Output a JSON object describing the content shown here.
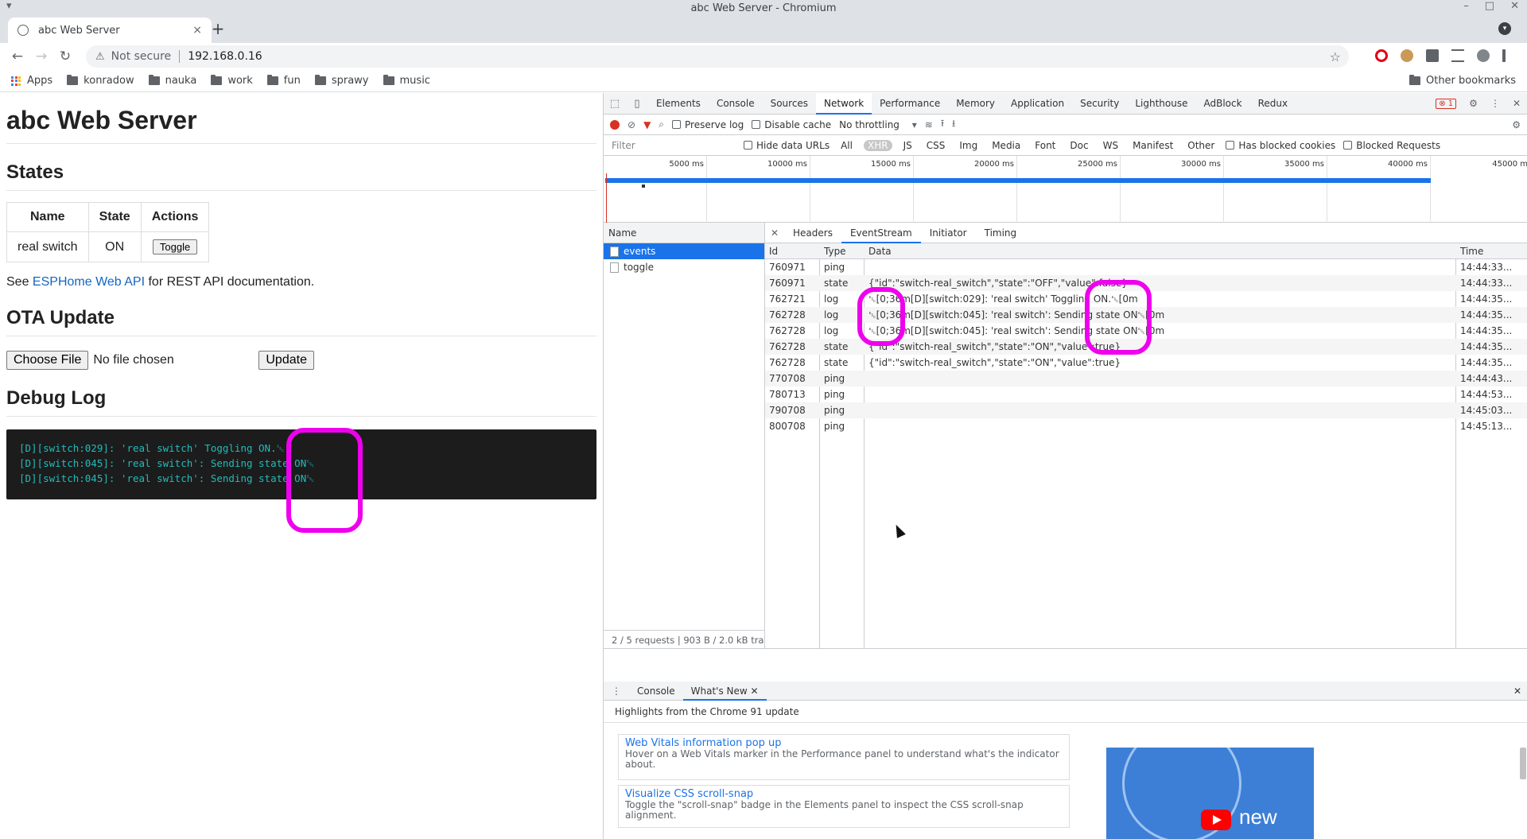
{
  "window": {
    "title": "abc Web Server - Chromium"
  },
  "tab": {
    "title": "abc Web Server",
    "close": "×",
    "new": "+"
  },
  "toolbar": {
    "security": "Not secure",
    "url": "192.168.0.16"
  },
  "bookmarks": {
    "items": [
      "Apps",
      "konradow",
      "nauka",
      "work",
      "fun",
      "sprawy",
      "music"
    ],
    "other": "Other bookmarks"
  },
  "page": {
    "title": "abc Web Server",
    "states_heading": "States",
    "table": {
      "headers": [
        "Name",
        "State",
        "Actions"
      ],
      "rows": [
        {
          "name": "real switch",
          "state": "ON",
          "action": "Toggle"
        }
      ]
    },
    "api_prefix": "See ",
    "api_link": "ESPHome Web API",
    "api_suffix": " for REST API documentation.",
    "ota_heading": "OTA Update",
    "choose_file": "Choose File",
    "no_file": "No file chosen",
    "update": "Update",
    "debug_heading": "Debug Log",
    "log_lines": [
      "[D][switch:029]: 'real switch' Toggling ON.␛",
      "[D][switch:045]: 'real switch': Sending state ON␛",
      "[D][switch:045]: 'real switch': Sending state ON␛"
    ]
  },
  "devtools": {
    "tabs": [
      "Elements",
      "Console",
      "Sources",
      "Network",
      "Performance",
      "Memory",
      "Application",
      "Security",
      "Lighthouse",
      "AdBlock",
      "Redux"
    ],
    "active_tab": "Network",
    "error_count": "1",
    "toolbar": {
      "preserve_log": "Preserve log",
      "disable_cache": "Disable cache",
      "throttling": "No throttling"
    },
    "filter": {
      "placeholder": "Filter",
      "hide_data_urls": "Hide data URLs",
      "types": [
        "All",
        "XHR",
        "JS",
        "CSS",
        "Img",
        "Media",
        "Font",
        "Doc",
        "WS",
        "Manifest",
        "Other"
      ],
      "active_type": "XHR",
      "has_blocked_cookies": "Has blocked cookies",
      "blocked_requests": "Blocked Requests"
    },
    "timeline_ticks": [
      "5000 ms",
      "10000 ms",
      "15000 ms",
      "20000 ms",
      "25000 ms",
      "30000 ms",
      "35000 ms",
      "40000 ms",
      "45000 m"
    ],
    "requests_header": "Name",
    "requests": [
      "events",
      "toggle"
    ],
    "selected_request": "events",
    "footer": "2 / 5 requests  |  903 B / 2.0 kB tra",
    "detail_tabs": [
      "Headers",
      "EventStream",
      "Initiator",
      "Timing"
    ],
    "active_detail_tab": "EventStream",
    "eventstream": {
      "columns": [
        "Id",
        "Type",
        "Data",
        "Time"
      ],
      "rows": [
        {
          "id": "760971",
          "type": "ping",
          "data": "",
          "time": "14:44:33..."
        },
        {
          "id": "760971",
          "type": "state",
          "data": "{\"id\":\"switch-real_switch\",\"state\":\"OFF\",\"value\":false}",
          "time": "14:44:33..."
        },
        {
          "id": "762721",
          "type": "log",
          "data": "␛[0;36m[D][switch:029]: 'real switch' Toggling ON.␛[0m",
          "time": "14:44:35..."
        },
        {
          "id": "762728",
          "type": "log",
          "data": "␛[0;36m[D][switch:045]: 'real switch': Sending state ON␛[0m",
          "time": "14:44:35..."
        },
        {
          "id": "762728",
          "type": "log",
          "data": "␛[0;36m[D][switch:045]: 'real switch': Sending state ON␛[0m",
          "time": "14:44:35..."
        },
        {
          "id": "762728",
          "type": "state",
          "data": "{\"id\":\"switch-real_switch\",\"state\":\"ON\",\"value\":true}",
          "time": "14:44:35..."
        },
        {
          "id": "762728",
          "type": "state",
          "data": "{\"id\":\"switch-real_switch\",\"state\":\"ON\",\"value\":true}",
          "time": "14:44:35..."
        },
        {
          "id": "770708",
          "type": "ping",
          "data": "",
          "time": "14:44:43..."
        },
        {
          "id": "780713",
          "type": "ping",
          "data": "",
          "time": "14:44:53..."
        },
        {
          "id": "790708",
          "type": "ping",
          "data": "",
          "time": "14:45:03..."
        },
        {
          "id": "800708",
          "type": "ping",
          "data": "",
          "time": "14:45:13..."
        }
      ]
    },
    "drawer": {
      "tabs": [
        "Console",
        "What's New"
      ],
      "active": "What's New",
      "subtitle": "Highlights from the Chrome 91 update",
      "cards": [
        {
          "title": "Web Vitals information pop up",
          "desc": "Hover on a Web Vitals marker in the Performance panel to understand what's the indicator about."
        },
        {
          "title": "Visualize CSS scroll-snap",
          "desc": "Toggle the \"scroll-snap\" badge in the Elements panel to inspect the CSS scroll-snap alignment."
        }
      ],
      "thumb_text": "new"
    }
  },
  "colors": {
    "highlight": "#ee00ee",
    "accent": "#1a73e8",
    "terminal_text": "#22bbbb"
  }
}
